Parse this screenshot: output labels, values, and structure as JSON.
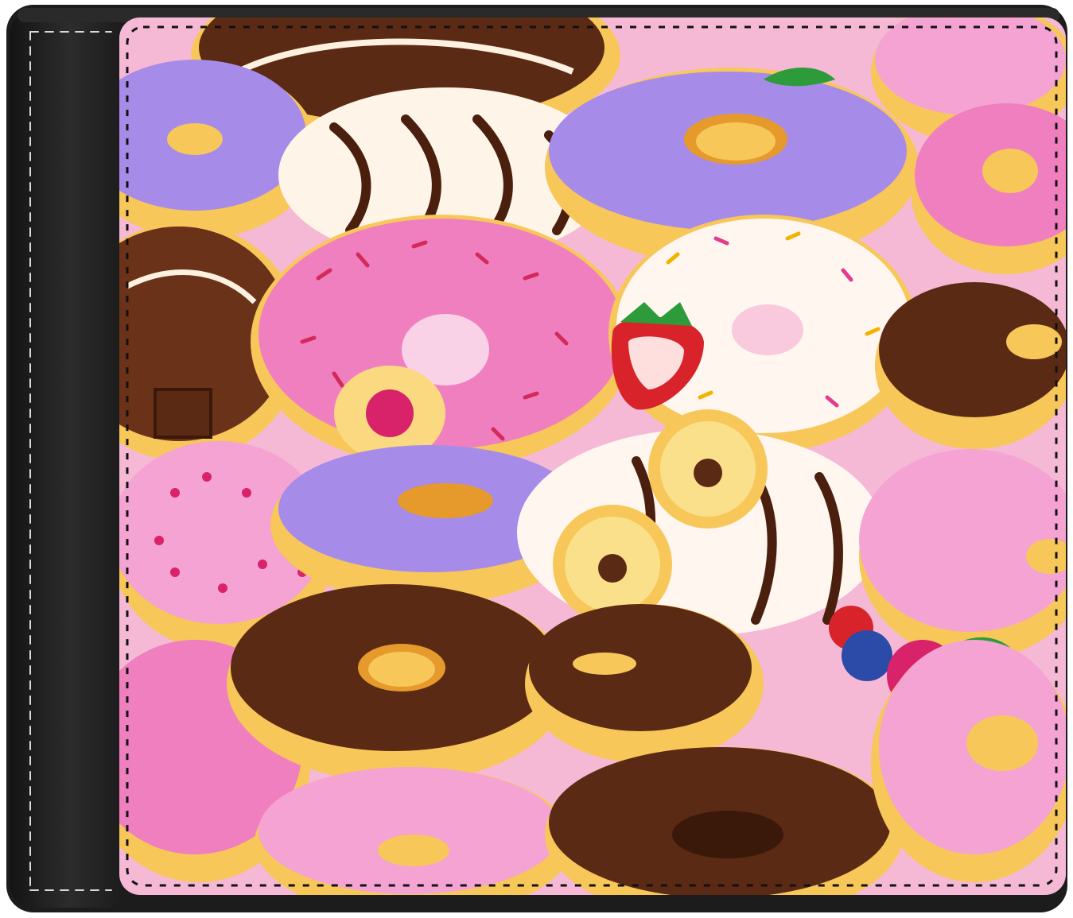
{
  "image": {
    "subject": "bifold-wallet",
    "pattern": "donut-print",
    "colors": {
      "leather": "#1f1f1f",
      "leather_highlight": "#3a3a3a",
      "stitch": "#f2f2f2",
      "background_pink": "#f5b9d6",
      "pink_glaze": "#f07fbf",
      "lavender_glaze": "#a78be8",
      "chocolate_glaze": "#5b2a14",
      "white_glaze": "#fff6ef",
      "dough": "#f7c75a",
      "dough_dark": "#e59a2b",
      "strawberry": "#d8232a",
      "blueberry": "#2c4aa8"
    }
  }
}
